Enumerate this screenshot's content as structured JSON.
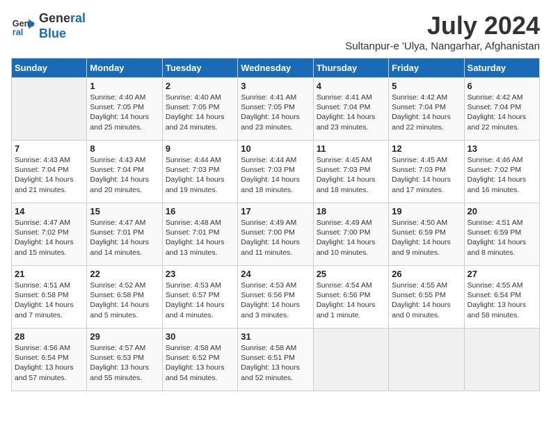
{
  "header": {
    "logo_line1": "General",
    "logo_line2": "Blue",
    "month_year": "July 2024",
    "location": "Sultanpur-e 'Ulya, Nangarhar, Afghanistan"
  },
  "days_of_week": [
    "Sunday",
    "Monday",
    "Tuesday",
    "Wednesday",
    "Thursday",
    "Friday",
    "Saturday"
  ],
  "weeks": [
    [
      {
        "day": "",
        "info": ""
      },
      {
        "day": "1",
        "info": "Sunrise: 4:40 AM\nSunset: 7:05 PM\nDaylight: 14 hours\nand 25 minutes."
      },
      {
        "day": "2",
        "info": "Sunrise: 4:40 AM\nSunset: 7:05 PM\nDaylight: 14 hours\nand 24 minutes."
      },
      {
        "day": "3",
        "info": "Sunrise: 4:41 AM\nSunset: 7:05 PM\nDaylight: 14 hours\nand 23 minutes."
      },
      {
        "day": "4",
        "info": "Sunrise: 4:41 AM\nSunset: 7:04 PM\nDaylight: 14 hours\nand 23 minutes."
      },
      {
        "day": "5",
        "info": "Sunrise: 4:42 AM\nSunset: 7:04 PM\nDaylight: 14 hours\nand 22 minutes."
      },
      {
        "day": "6",
        "info": "Sunrise: 4:42 AM\nSunset: 7:04 PM\nDaylight: 14 hours\nand 22 minutes."
      }
    ],
    [
      {
        "day": "7",
        "info": "Sunrise: 4:43 AM\nSunset: 7:04 PM\nDaylight: 14 hours\nand 21 minutes."
      },
      {
        "day": "8",
        "info": "Sunrise: 4:43 AM\nSunset: 7:04 PM\nDaylight: 14 hours\nand 20 minutes."
      },
      {
        "day": "9",
        "info": "Sunrise: 4:44 AM\nSunset: 7:03 PM\nDaylight: 14 hours\nand 19 minutes."
      },
      {
        "day": "10",
        "info": "Sunrise: 4:44 AM\nSunset: 7:03 PM\nDaylight: 14 hours\nand 18 minutes."
      },
      {
        "day": "11",
        "info": "Sunrise: 4:45 AM\nSunset: 7:03 PM\nDaylight: 14 hours\nand 18 minutes."
      },
      {
        "day": "12",
        "info": "Sunrise: 4:45 AM\nSunset: 7:03 PM\nDaylight: 14 hours\nand 17 minutes."
      },
      {
        "day": "13",
        "info": "Sunrise: 4:46 AM\nSunset: 7:02 PM\nDaylight: 14 hours\nand 16 minutes."
      }
    ],
    [
      {
        "day": "14",
        "info": "Sunrise: 4:47 AM\nSunset: 7:02 PM\nDaylight: 14 hours\nand 15 minutes."
      },
      {
        "day": "15",
        "info": "Sunrise: 4:47 AM\nSunset: 7:01 PM\nDaylight: 14 hours\nand 14 minutes."
      },
      {
        "day": "16",
        "info": "Sunrise: 4:48 AM\nSunset: 7:01 PM\nDaylight: 14 hours\nand 13 minutes."
      },
      {
        "day": "17",
        "info": "Sunrise: 4:49 AM\nSunset: 7:00 PM\nDaylight: 14 hours\nand 11 minutes."
      },
      {
        "day": "18",
        "info": "Sunrise: 4:49 AM\nSunset: 7:00 PM\nDaylight: 14 hours\nand 10 minutes."
      },
      {
        "day": "19",
        "info": "Sunrise: 4:50 AM\nSunset: 6:59 PM\nDaylight: 14 hours\nand 9 minutes."
      },
      {
        "day": "20",
        "info": "Sunrise: 4:51 AM\nSunset: 6:59 PM\nDaylight: 14 hours\nand 8 minutes."
      }
    ],
    [
      {
        "day": "21",
        "info": "Sunrise: 4:51 AM\nSunset: 6:58 PM\nDaylight: 14 hours\nand 7 minutes."
      },
      {
        "day": "22",
        "info": "Sunrise: 4:52 AM\nSunset: 6:58 PM\nDaylight: 14 hours\nand 5 minutes."
      },
      {
        "day": "23",
        "info": "Sunrise: 4:53 AM\nSunset: 6:57 PM\nDaylight: 14 hours\nand 4 minutes."
      },
      {
        "day": "24",
        "info": "Sunrise: 4:53 AM\nSunset: 6:56 PM\nDaylight: 14 hours\nand 3 minutes."
      },
      {
        "day": "25",
        "info": "Sunrise: 4:54 AM\nSunset: 6:56 PM\nDaylight: 14 hours\nand 1 minute."
      },
      {
        "day": "26",
        "info": "Sunrise: 4:55 AM\nSunset: 6:55 PM\nDaylight: 14 hours\nand 0 minutes."
      },
      {
        "day": "27",
        "info": "Sunrise: 4:55 AM\nSunset: 6:54 PM\nDaylight: 13 hours\nand 58 minutes."
      }
    ],
    [
      {
        "day": "28",
        "info": "Sunrise: 4:56 AM\nSunset: 6:54 PM\nDaylight: 13 hours\nand 57 minutes."
      },
      {
        "day": "29",
        "info": "Sunrise: 4:57 AM\nSunset: 6:53 PM\nDaylight: 13 hours\nand 55 minutes."
      },
      {
        "day": "30",
        "info": "Sunrise: 4:58 AM\nSunset: 6:52 PM\nDaylight: 13 hours\nand 54 minutes."
      },
      {
        "day": "31",
        "info": "Sunrise: 4:58 AM\nSunset: 6:51 PM\nDaylight: 13 hours\nand 52 minutes."
      },
      {
        "day": "",
        "info": ""
      },
      {
        "day": "",
        "info": ""
      },
      {
        "day": "",
        "info": ""
      }
    ]
  ]
}
